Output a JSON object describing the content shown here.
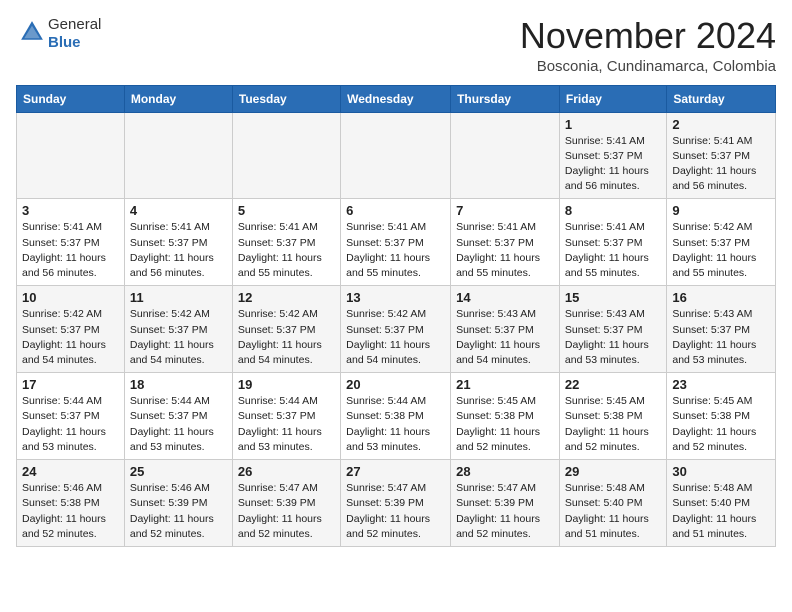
{
  "header": {
    "logo_general": "General",
    "logo_blue": "Blue",
    "month_title": "November 2024",
    "location": "Bosconia, Cundinamarca, Colombia"
  },
  "days_of_week": [
    "Sunday",
    "Monday",
    "Tuesday",
    "Wednesday",
    "Thursday",
    "Friday",
    "Saturday"
  ],
  "weeks": [
    [
      {
        "day": "",
        "info": ""
      },
      {
        "day": "",
        "info": ""
      },
      {
        "day": "",
        "info": ""
      },
      {
        "day": "",
        "info": ""
      },
      {
        "day": "",
        "info": ""
      },
      {
        "day": "1",
        "info": "Sunrise: 5:41 AM\nSunset: 5:37 PM\nDaylight: 11 hours and 56 minutes."
      },
      {
        "day": "2",
        "info": "Sunrise: 5:41 AM\nSunset: 5:37 PM\nDaylight: 11 hours and 56 minutes."
      }
    ],
    [
      {
        "day": "3",
        "info": "Sunrise: 5:41 AM\nSunset: 5:37 PM\nDaylight: 11 hours and 56 minutes."
      },
      {
        "day": "4",
        "info": "Sunrise: 5:41 AM\nSunset: 5:37 PM\nDaylight: 11 hours and 56 minutes."
      },
      {
        "day": "5",
        "info": "Sunrise: 5:41 AM\nSunset: 5:37 PM\nDaylight: 11 hours and 55 minutes."
      },
      {
        "day": "6",
        "info": "Sunrise: 5:41 AM\nSunset: 5:37 PM\nDaylight: 11 hours and 55 minutes."
      },
      {
        "day": "7",
        "info": "Sunrise: 5:41 AM\nSunset: 5:37 PM\nDaylight: 11 hours and 55 minutes."
      },
      {
        "day": "8",
        "info": "Sunrise: 5:41 AM\nSunset: 5:37 PM\nDaylight: 11 hours and 55 minutes."
      },
      {
        "day": "9",
        "info": "Sunrise: 5:42 AM\nSunset: 5:37 PM\nDaylight: 11 hours and 55 minutes."
      }
    ],
    [
      {
        "day": "10",
        "info": "Sunrise: 5:42 AM\nSunset: 5:37 PM\nDaylight: 11 hours and 54 minutes."
      },
      {
        "day": "11",
        "info": "Sunrise: 5:42 AM\nSunset: 5:37 PM\nDaylight: 11 hours and 54 minutes."
      },
      {
        "day": "12",
        "info": "Sunrise: 5:42 AM\nSunset: 5:37 PM\nDaylight: 11 hours and 54 minutes."
      },
      {
        "day": "13",
        "info": "Sunrise: 5:42 AM\nSunset: 5:37 PM\nDaylight: 11 hours and 54 minutes."
      },
      {
        "day": "14",
        "info": "Sunrise: 5:43 AM\nSunset: 5:37 PM\nDaylight: 11 hours and 54 minutes."
      },
      {
        "day": "15",
        "info": "Sunrise: 5:43 AM\nSunset: 5:37 PM\nDaylight: 11 hours and 53 minutes."
      },
      {
        "day": "16",
        "info": "Sunrise: 5:43 AM\nSunset: 5:37 PM\nDaylight: 11 hours and 53 minutes."
      }
    ],
    [
      {
        "day": "17",
        "info": "Sunrise: 5:44 AM\nSunset: 5:37 PM\nDaylight: 11 hours and 53 minutes."
      },
      {
        "day": "18",
        "info": "Sunrise: 5:44 AM\nSunset: 5:37 PM\nDaylight: 11 hours and 53 minutes."
      },
      {
        "day": "19",
        "info": "Sunrise: 5:44 AM\nSunset: 5:37 PM\nDaylight: 11 hours and 53 minutes."
      },
      {
        "day": "20",
        "info": "Sunrise: 5:44 AM\nSunset: 5:38 PM\nDaylight: 11 hours and 53 minutes."
      },
      {
        "day": "21",
        "info": "Sunrise: 5:45 AM\nSunset: 5:38 PM\nDaylight: 11 hours and 52 minutes."
      },
      {
        "day": "22",
        "info": "Sunrise: 5:45 AM\nSunset: 5:38 PM\nDaylight: 11 hours and 52 minutes."
      },
      {
        "day": "23",
        "info": "Sunrise: 5:45 AM\nSunset: 5:38 PM\nDaylight: 11 hours and 52 minutes."
      }
    ],
    [
      {
        "day": "24",
        "info": "Sunrise: 5:46 AM\nSunset: 5:38 PM\nDaylight: 11 hours and 52 minutes."
      },
      {
        "day": "25",
        "info": "Sunrise: 5:46 AM\nSunset: 5:39 PM\nDaylight: 11 hours and 52 minutes."
      },
      {
        "day": "26",
        "info": "Sunrise: 5:47 AM\nSunset: 5:39 PM\nDaylight: 11 hours and 52 minutes."
      },
      {
        "day": "27",
        "info": "Sunrise: 5:47 AM\nSunset: 5:39 PM\nDaylight: 11 hours and 52 minutes."
      },
      {
        "day": "28",
        "info": "Sunrise: 5:47 AM\nSunset: 5:39 PM\nDaylight: 11 hours and 52 minutes."
      },
      {
        "day": "29",
        "info": "Sunrise: 5:48 AM\nSunset: 5:40 PM\nDaylight: 11 hours and 51 minutes."
      },
      {
        "day": "30",
        "info": "Sunrise: 5:48 AM\nSunset: 5:40 PM\nDaylight: 11 hours and 51 minutes."
      }
    ]
  ]
}
